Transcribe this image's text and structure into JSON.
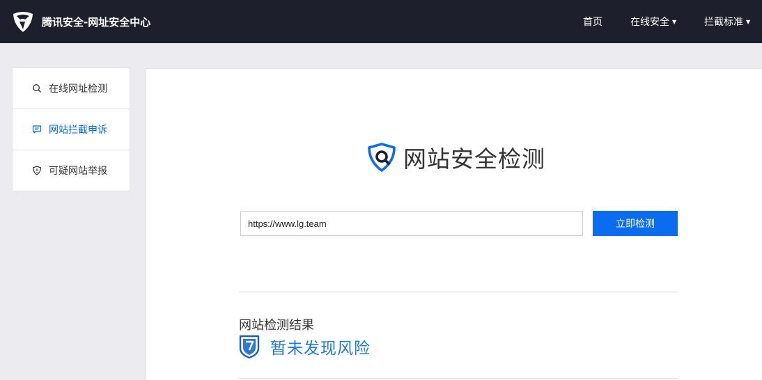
{
  "header": {
    "brand": "腾讯安全-网址安全中心",
    "nav": [
      {
        "label": "首页"
      },
      {
        "label": "在线安全",
        "caret": "▼"
      },
      {
        "label": "拦截标准",
        "caret": "▼"
      }
    ]
  },
  "sidebar": {
    "items": [
      {
        "label": "在线网址检测",
        "icon": "search-icon",
        "active": false
      },
      {
        "label": "网站拦截申诉",
        "icon": "comment-icon",
        "active": true
      },
      {
        "label": "可疑网站举报",
        "icon": "shield-alert-icon",
        "active": false
      }
    ]
  },
  "main": {
    "title": "网站安全检测",
    "url_value": "https://www.lg.team",
    "check_button": "立即检测",
    "result_label": "网站检测结果",
    "result_text": "暂未发现风险"
  },
  "colors": {
    "topbar": "#1e1f2c",
    "accent": "#0a6cf0",
    "result": "#1e7ae8"
  }
}
